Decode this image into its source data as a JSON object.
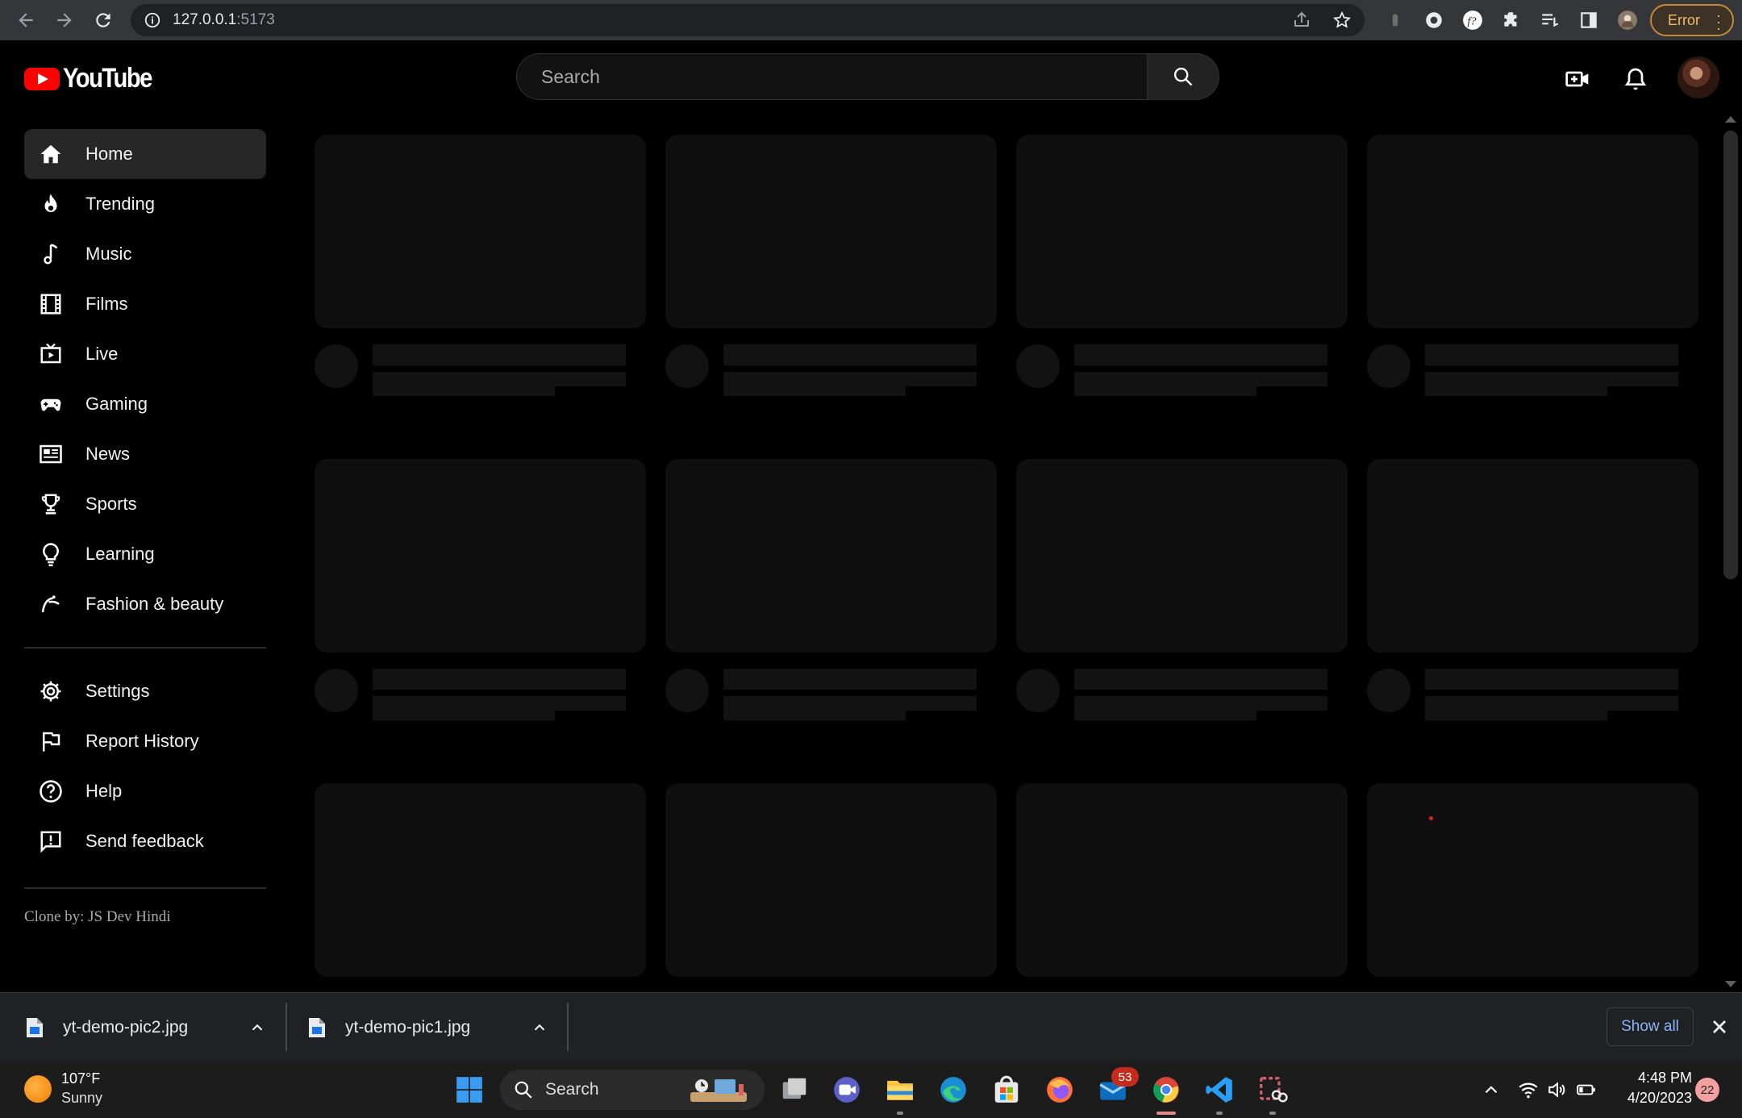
{
  "browser": {
    "url_host": "127.0.0.1",
    "url_port": ":5173",
    "error_label": "Error"
  },
  "app": {
    "logo_text": "YouTube",
    "search_placeholder": "Search",
    "sidebar_primary": [
      {
        "label": "Home",
        "icon": "home-icon",
        "active": true
      },
      {
        "label": "Trending",
        "icon": "fire-icon"
      },
      {
        "label": "Music",
        "icon": "music-note-icon"
      },
      {
        "label": "Films",
        "icon": "film-icon"
      },
      {
        "label": "Live",
        "icon": "live-tv-icon"
      },
      {
        "label": "Gaming",
        "icon": "gamepad-icon"
      },
      {
        "label": "News",
        "icon": "newspaper-icon"
      },
      {
        "label": "Sports",
        "icon": "trophy-icon"
      },
      {
        "label": "Learning",
        "icon": "lightbulb-icon"
      },
      {
        "label": "Fashion & beauty",
        "icon": "hanger-icon"
      }
    ],
    "sidebar_secondary": [
      {
        "label": "Settings",
        "icon": "gear-icon"
      },
      {
        "label": "Report History",
        "icon": "flag-icon"
      },
      {
        "label": "Help",
        "icon": "help-icon"
      },
      {
        "label": "Send feedback",
        "icon": "feedback-icon"
      }
    ],
    "credit": "Clone by: JS Dev Hindi"
  },
  "downloads": {
    "items": [
      {
        "filename": "yt-demo-pic2.jpg"
      },
      {
        "filename": "yt-demo-pic1.jpg"
      }
    ],
    "show_all_label": "Show all"
  },
  "taskbar": {
    "weather_temp": "107°F",
    "weather_desc": "Sunny",
    "search_label": "Search",
    "mail_badge": "53",
    "time": "4:48 PM",
    "date": "4/20/2023",
    "notification_count": "22"
  }
}
